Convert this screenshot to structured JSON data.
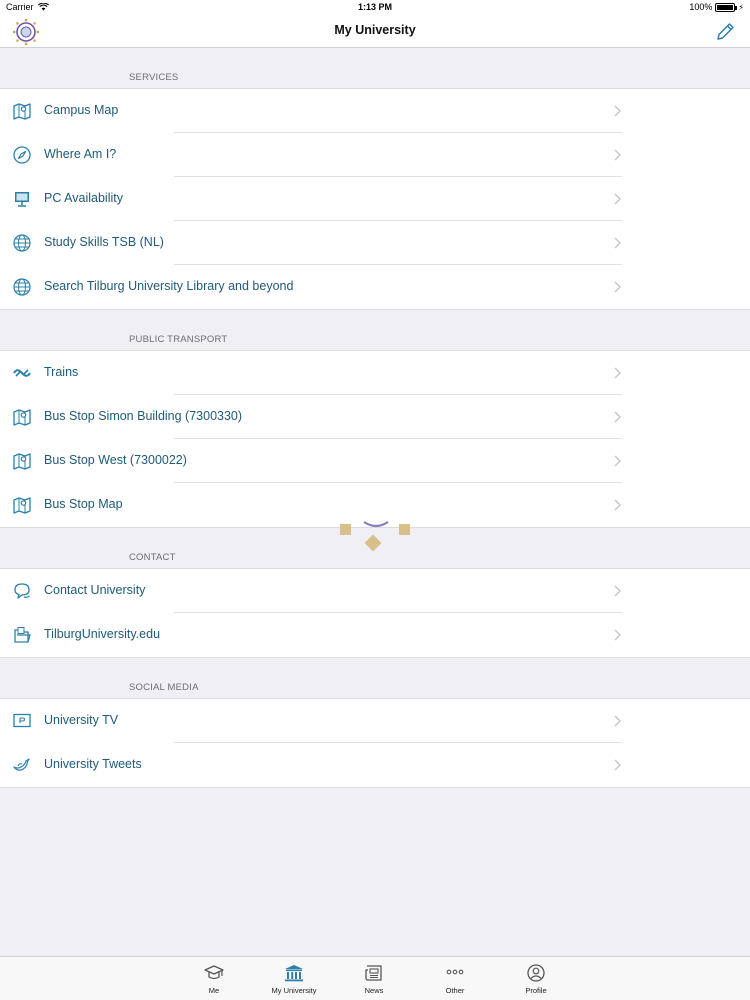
{
  "status_bar": {
    "carrier": "Carrier",
    "time": "1:13 PM",
    "battery": "100%",
    "battery_level": 1.0
  },
  "nav": {
    "title": "My University",
    "edit_icon": "pencil-icon",
    "logo_icon": "university-seal-icon"
  },
  "colors": {
    "accent": "#2b7fa8",
    "text": "#1f5a78",
    "background": "#efeff4",
    "gold": "#c9a44f"
  },
  "sections": [
    {
      "header": "SERVICES",
      "items": [
        {
          "label": "Campus Map",
          "icon": "map-pin-icon"
        },
        {
          "label": "Where Am I?",
          "icon": "compass-icon"
        },
        {
          "label": "PC Availability",
          "icon": "monitor-icon"
        },
        {
          "label": "Study Skills TSB (NL)",
          "icon": "globe-icon"
        },
        {
          "label": "Search Tilburg University Library and beyond",
          "icon": "globe-icon"
        }
      ]
    },
    {
      "header": "PUBLIC TRANSPORT",
      "items": [
        {
          "label": "Trains",
          "icon": "ns-train-icon"
        },
        {
          "label": "Bus Stop Simon Building (7300330)",
          "icon": "map-pin-icon"
        },
        {
          "label": "Bus Stop West (7300022)",
          "icon": "map-pin-icon"
        },
        {
          "label": "Bus Stop Map",
          "icon": "map-pin-icon"
        }
      ]
    },
    {
      "header": "CONTACT",
      "items": [
        {
          "label": "Contact University",
          "icon": "chat-bubbles-icon"
        },
        {
          "label": "TilburgUniversity.edu",
          "icon": "folder-icon"
        }
      ]
    },
    {
      "header": "SOCIAL MEDIA",
      "items": [
        {
          "label": "University TV",
          "icon": "tv-play-icon"
        },
        {
          "label": "University Tweets",
          "icon": "bird-icon"
        }
      ]
    }
  ],
  "tabs": [
    {
      "label": "Me",
      "icon": "graduation-cap-icon",
      "active": false
    },
    {
      "label": "My University",
      "icon": "building-columns-icon",
      "active": true
    },
    {
      "label": "News",
      "icon": "newspaper-icon",
      "active": false
    },
    {
      "label": "Other",
      "icon": "more-dots-icon",
      "active": false
    },
    {
      "label": "Profile",
      "icon": "person-circle-icon",
      "active": false
    }
  ]
}
